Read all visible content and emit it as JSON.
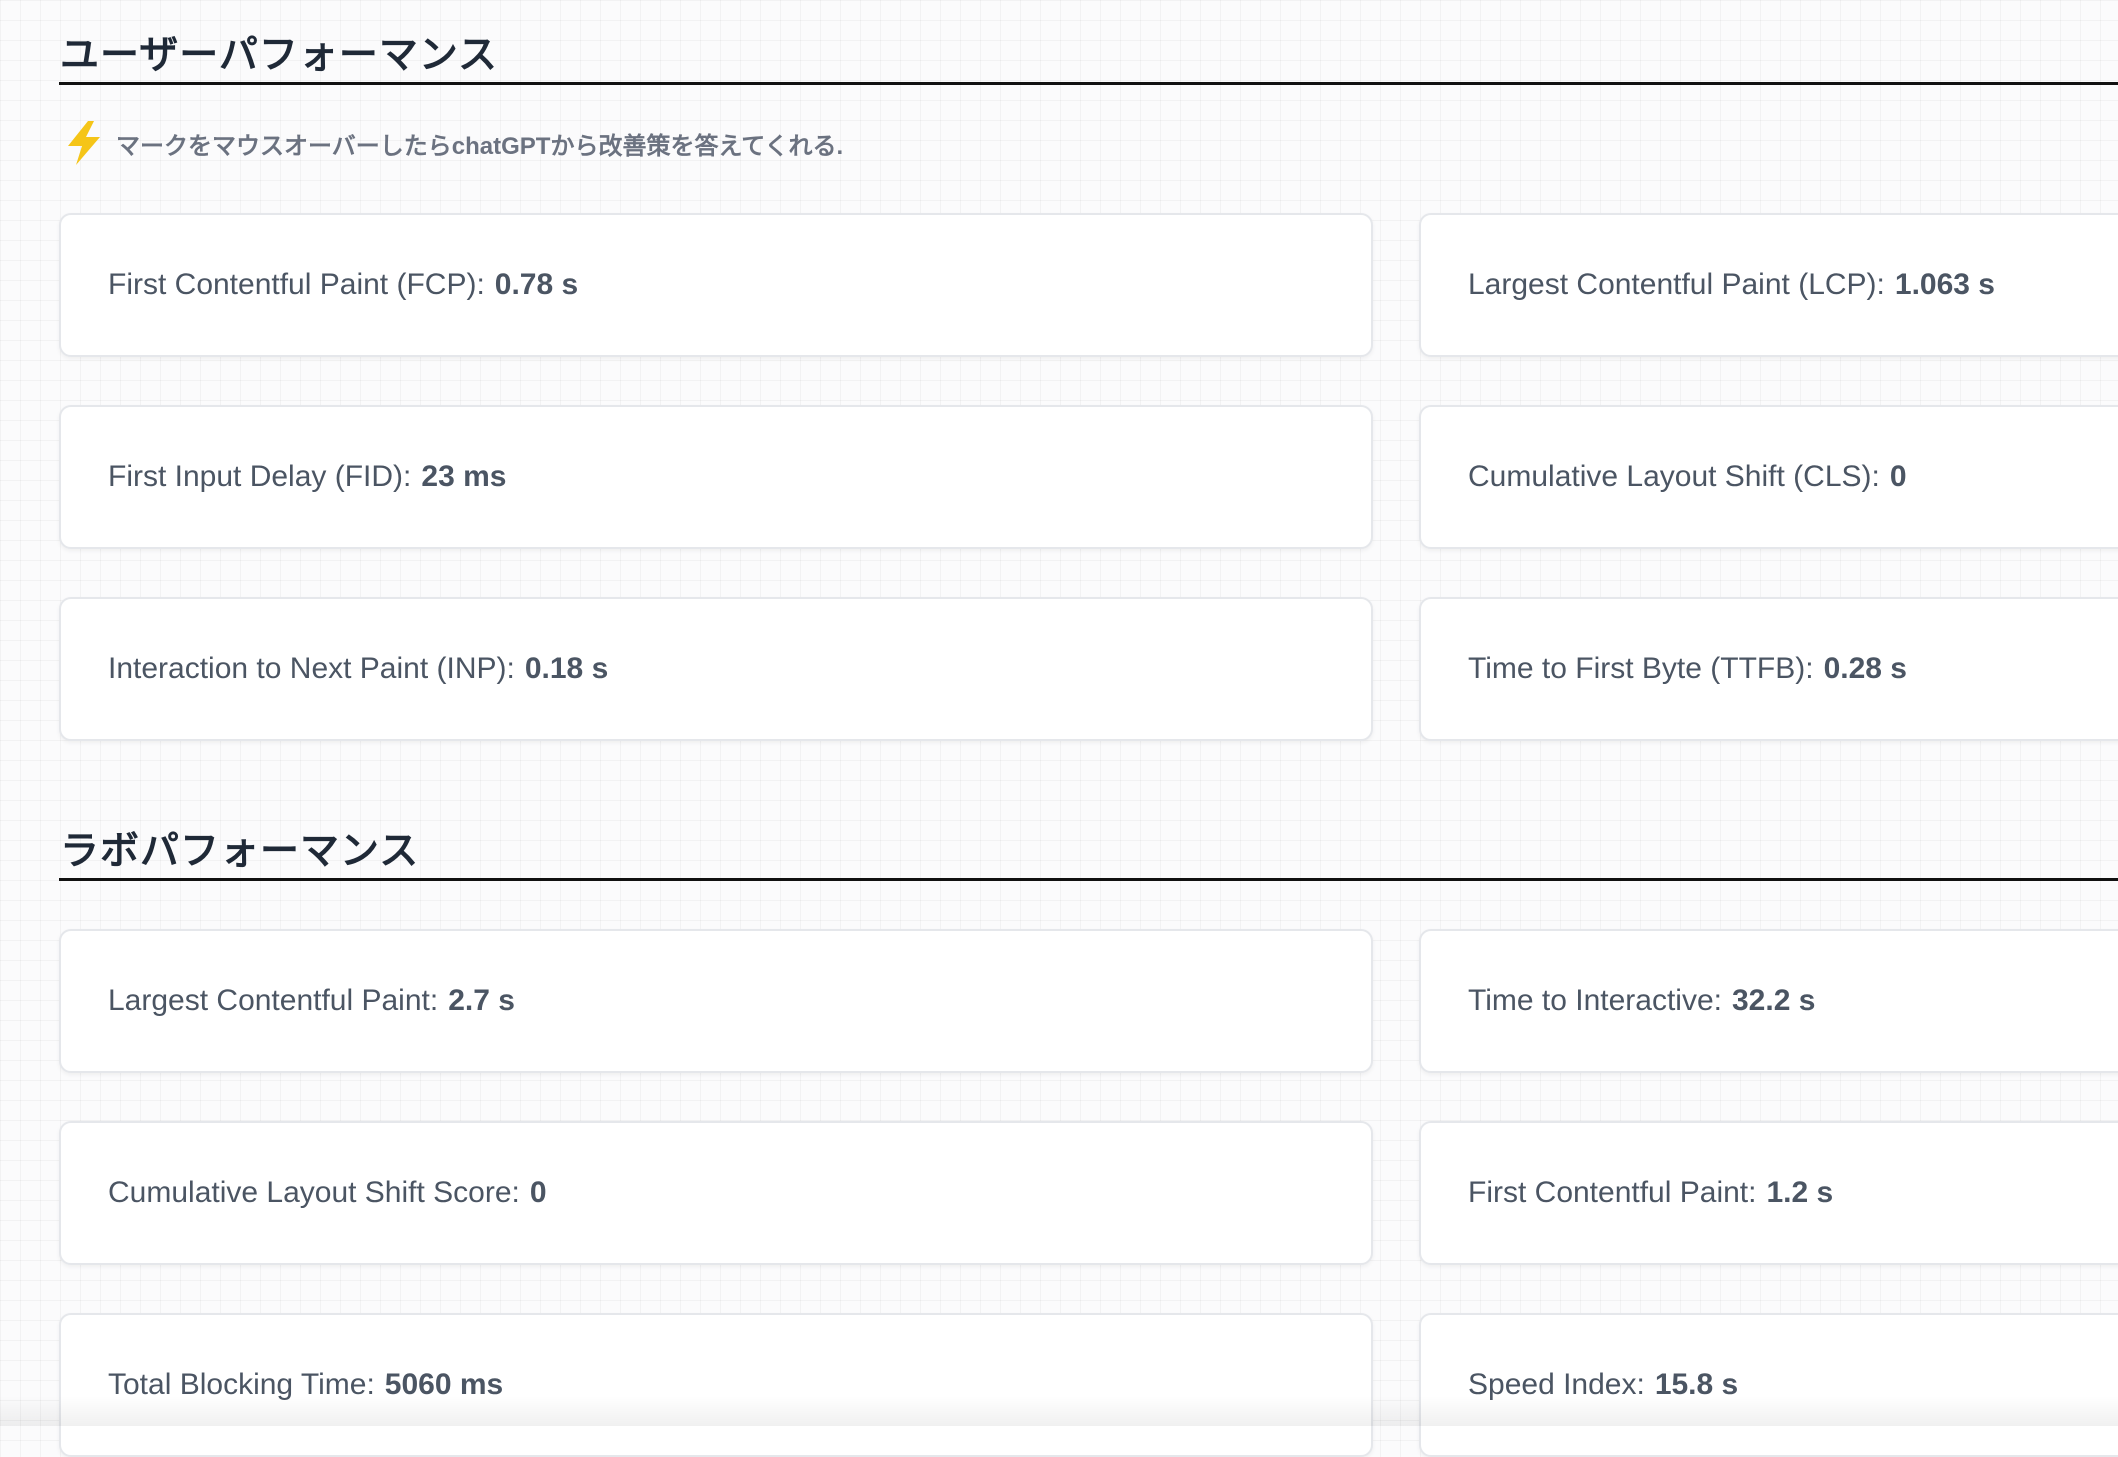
{
  "user_performance": {
    "title": "ユーザーパフォーマンス",
    "note_icon": "lightning-icon",
    "note_text": "マークをマウスオーバーしたらchatGPTから改善策を答えてくれる.",
    "metrics": [
      {
        "label": "First Contentful Paint (FCP):",
        "value": "0.78 s"
      },
      {
        "label": "Largest Contentful Paint (LCP):",
        "value": "1.063 s"
      },
      {
        "label": "First Input Delay (FID):",
        "value": "23 ms"
      },
      {
        "label": "Cumulative Layout Shift (CLS):",
        "value": "0"
      },
      {
        "label": "Interaction to Next Paint (INP):",
        "value": "0.18 s"
      },
      {
        "label": "Time to First Byte (TTFB):",
        "value": "0.28 s"
      }
    ]
  },
  "lab_performance": {
    "title": "ラボパフォーマンス",
    "metrics": [
      {
        "label": "Largest Contentful Paint:",
        "value": "2.7 s"
      },
      {
        "label": "Time to Interactive:",
        "value": "32.2 s"
      },
      {
        "label": "Cumulative Layout Shift Score:",
        "value": "0"
      },
      {
        "label": "First Contentful Paint:",
        "value": "1.2 s"
      },
      {
        "label": "Total Blocking Time:",
        "value": "5060 ms"
      },
      {
        "label": "Speed Index:",
        "value": "15.8 s"
      }
    ]
  },
  "colors": {
    "lightning": "#f5c518",
    "rule": "#111111",
    "card_border": "#e5e7eb"
  }
}
